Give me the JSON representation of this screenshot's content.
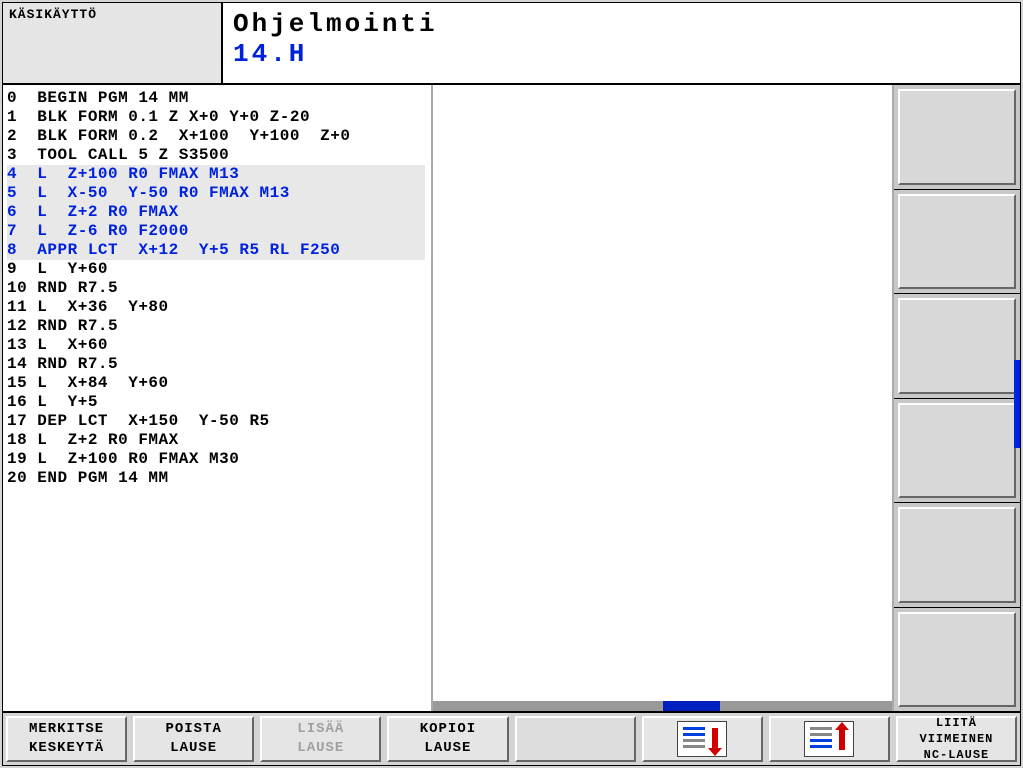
{
  "header": {
    "mode": "KÄSIKÄYTTÖ",
    "title": "Ohjelmointi",
    "file": "14.H"
  },
  "code": [
    {
      "n": "0",
      "t": "  BEGIN PGM 14 MM",
      "hl": false
    },
    {
      "n": "1",
      "t": "  BLK FORM 0.1 Z X+0 Y+0 Z-20",
      "hl": false
    },
    {
      "n": "2",
      "t": "  BLK FORM 0.2  X+100  Y+100  Z+0",
      "hl": false
    },
    {
      "n": "3",
      "t": "  TOOL CALL 5 Z S3500",
      "hl": false
    },
    {
      "n": "4",
      "t": "  L  Z+100 R0 FMAX M13",
      "hl": true
    },
    {
      "n": "5",
      "t": "  L  X-50  Y-50 R0 FMAX M13",
      "hl": true
    },
    {
      "n": "6",
      "t": "  L  Z+2 R0 FMAX",
      "hl": true
    },
    {
      "n": "7",
      "t": "  L  Z-6 R0 F2000",
      "hl": true
    },
    {
      "n": "8",
      "t": "  APPR LCT  X+12  Y+5 R5 RL F250",
      "hl": true
    },
    {
      "n": "9",
      "t": "  L  Y+60",
      "hl": false
    },
    {
      "n": "10",
      "t": " RND R7.5",
      "hl": false
    },
    {
      "n": "11",
      "t": " L  X+36  Y+80",
      "hl": false
    },
    {
      "n": "12",
      "t": " RND R7.5",
      "hl": false
    },
    {
      "n": "13",
      "t": " L  X+60",
      "hl": false
    },
    {
      "n": "14",
      "t": " RND R7.5",
      "hl": false
    },
    {
      "n": "15",
      "t": " L  X+84  Y+60",
      "hl": false
    },
    {
      "n": "16",
      "t": " L  Y+5",
      "hl": false
    },
    {
      "n": "17",
      "t": " DEP LCT  X+150  Y-50 R5",
      "hl": false
    },
    {
      "n": "18",
      "t": " L  Z+2 R0 FMAX",
      "hl": false
    },
    {
      "n": "19",
      "t": " L  Z+100 R0 FMAX M30",
      "hl": false
    },
    {
      "n": "20",
      "t": " END PGM 14 MM",
      "hl": false
    }
  ],
  "softkeys": {
    "k1_l1": "MERKITSE",
    "k1_l2": "KESKEYTÄ",
    "k2_l1": "POISTA",
    "k2_l2": "LAUSE",
    "k3_l1": "LISÄÄ",
    "k3_l2": "LAUSE",
    "k4_l1": "KOPIOI",
    "k4_l2": "LAUSE",
    "k8_l1": "LIITÄ",
    "k8_l2": "VIIMEINEN",
    "k8_l3": "NC-LAUSE"
  }
}
